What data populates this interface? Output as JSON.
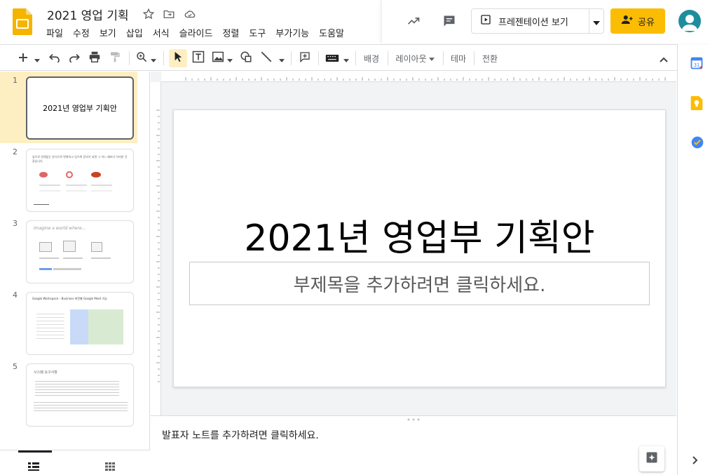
{
  "app": {
    "title": "2021 영업 기획"
  },
  "menu": [
    "파일",
    "수정",
    "보기",
    "삽입",
    "서식",
    "슬라이드",
    "정렬",
    "도구",
    "부가기능",
    "도움말"
  ],
  "header": {
    "present_label": "프레젠테이션 보기",
    "share_label": "공유"
  },
  "toolbar": {
    "background_label": "배경",
    "layout_label": "레이아웃",
    "theme_label": "테마",
    "transition_label": "전환"
  },
  "slides": [
    {
      "num": "1",
      "title": "2021년 영업부 기획안"
    },
    {
      "num": "2",
      "text": "앞으로 연례없는 방식으로 변화하고 있으며 준비가 되면 그 어느 때보다 이러한 것 같습니다."
    },
    {
      "num": "3",
      "text": "Imagine a world where..."
    },
    {
      "num": "4",
      "text": "Google Workspace – Business 버전별 Google Meet 기능"
    },
    {
      "num": "5",
      "text": "시스템 요구사항"
    }
  ],
  "main_slide": {
    "title": "2021년 영업부 기획안",
    "subtitle_placeholder": "부제목을 추가하려면 클릭하세요."
  },
  "notes": {
    "placeholder": "발표자 노트를 추가하려면 클릭하세요."
  },
  "colors": {
    "accent": "#fbbc04",
    "selected_slide_bg": "#feefc3",
    "avatar": "#1e8e9e"
  }
}
